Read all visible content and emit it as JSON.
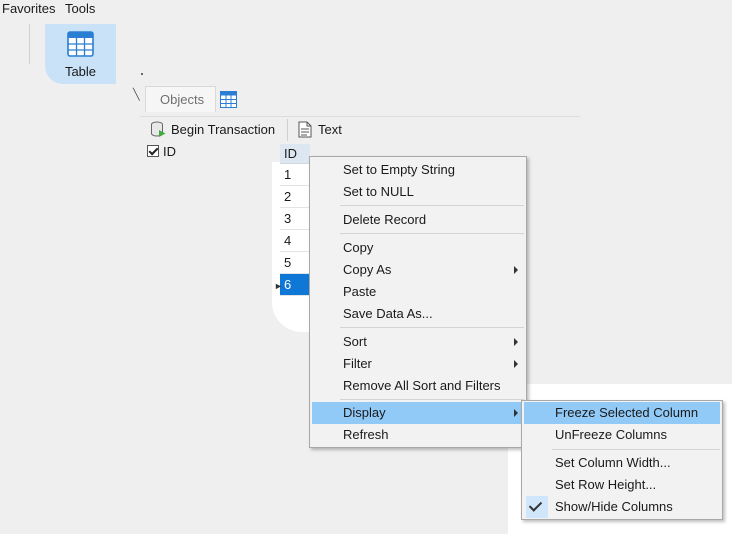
{
  "menubar": {
    "favorites": "Favorites",
    "tools": "Tools"
  },
  "ribbon": {
    "table_label": "Table",
    "table_icon": "table-icon"
  },
  "tabs": {
    "objects": "Objects"
  },
  "toolbar": {
    "begin_transaction": "Begin Transaction",
    "text": "Text"
  },
  "columns_panel": {
    "id_label": "ID",
    "id_checked": true
  },
  "grid": {
    "header": "ID",
    "rows": [
      "1",
      "2",
      "3",
      "4",
      "5",
      "6"
    ],
    "selected_row": "6"
  },
  "context_menu": {
    "items": {
      "set_empty": "Set to Empty String",
      "set_null": "Set to NULL",
      "delete_record": "Delete Record",
      "copy": "Copy",
      "copy_as": "Copy As",
      "paste": "Paste",
      "save_data_as": "Save Data As...",
      "sort": "Sort",
      "filter": "Filter",
      "remove_sort_filters": "Remove All Sort and Filters",
      "display": "Display",
      "refresh": "Refresh"
    }
  },
  "display_submenu": {
    "freeze": "Freeze Selected Column",
    "unfreeze": "UnFreeze Columns",
    "set_col_width": "Set Column Width...",
    "set_row_height": "Set Row Height...",
    "show_hide": "Show/Hide Columns"
  },
  "colors": {
    "highlight": "#91c9f7",
    "selected_row": "#0f78d7",
    "ribbon_active": "#c9e2f8"
  }
}
